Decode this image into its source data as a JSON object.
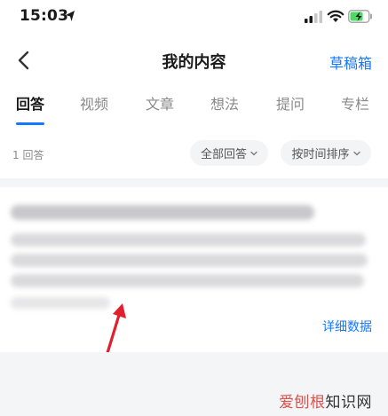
{
  "status_bar": {
    "time": "15:03"
  },
  "nav": {
    "title": "我的内容",
    "drafts_label": "草稿箱"
  },
  "tabs": [
    {
      "label": "回答",
      "active": true
    },
    {
      "label": "视频",
      "active": false
    },
    {
      "label": "文章",
      "active": false
    },
    {
      "label": "想法",
      "active": false
    },
    {
      "label": "提问",
      "active": false
    },
    {
      "label": "专栏",
      "active": false
    }
  ],
  "filters": {
    "count_label": "1 回答",
    "scope_label": "全部回答",
    "sort_label": "按时间排序"
  },
  "answer_card": {
    "detail_label": "详细数据"
  },
  "watermark": {
    "brand": "爱刨根",
    "suffix": "知识网"
  },
  "colors": {
    "accent": "#1677ff",
    "arrow": "#e0202e",
    "battery": "#4cd964"
  }
}
